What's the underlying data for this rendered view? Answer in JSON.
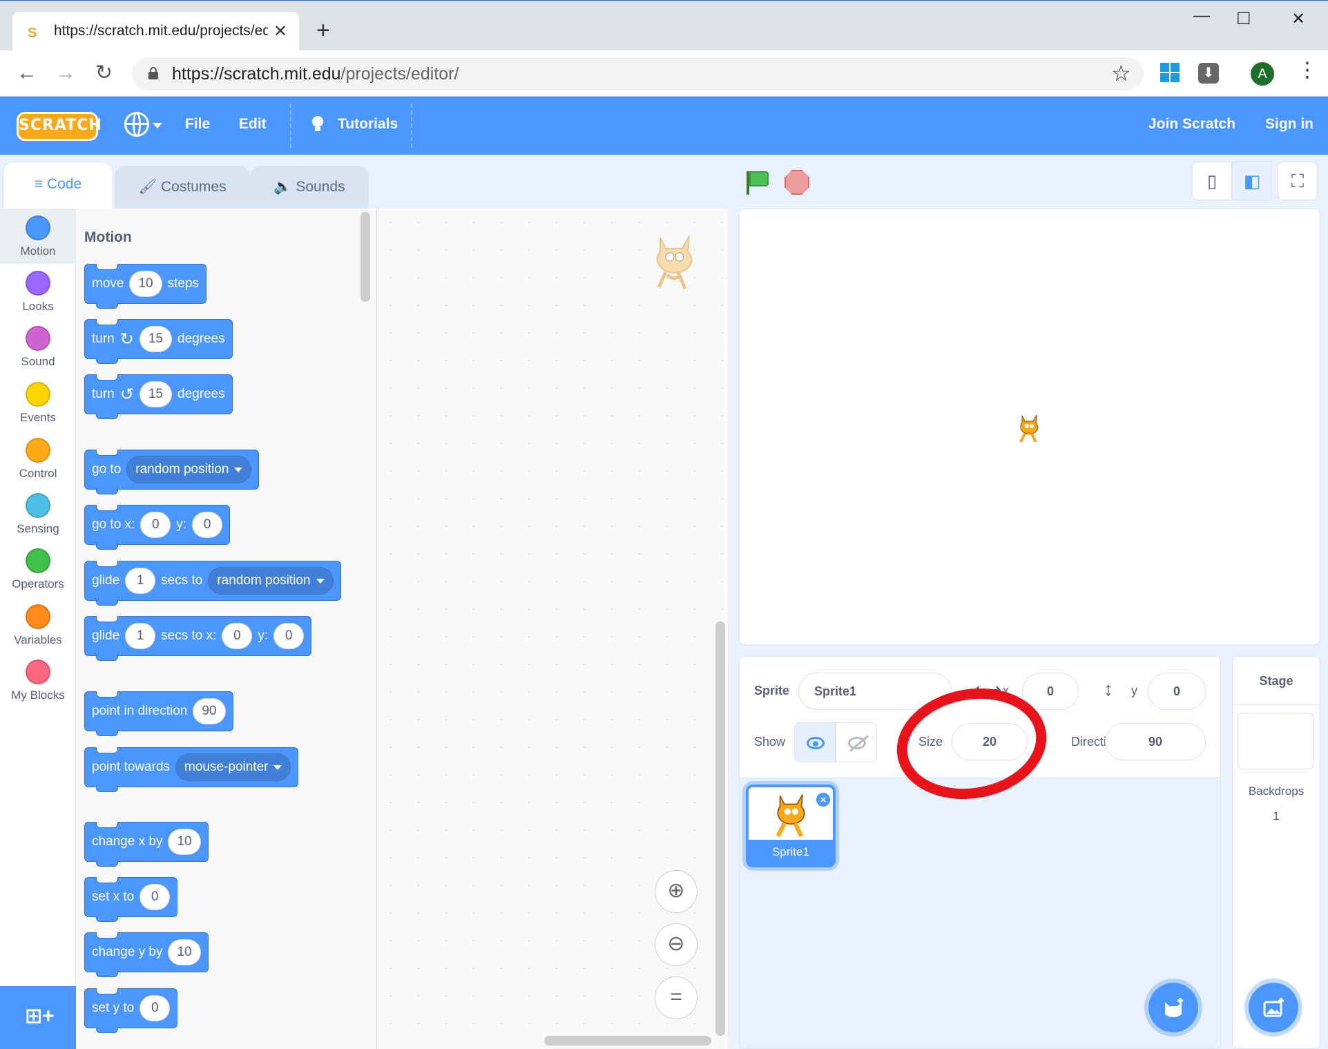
{
  "browser": {
    "tab_title": "https://scratch.mit.edu/projects/editor/",
    "tab_favicon": "S",
    "close_tab": "✕",
    "new_tab": "+",
    "window_minimize": "—",
    "window_maximize": "☐",
    "window_close": "✕",
    "back": "←",
    "forward": "→",
    "reload": "↻",
    "url_prefix": "https://scratch.mit.edu",
    "url_path": "/projects/editor/",
    "bookmark_star": "☆",
    "download_ext": "⬇",
    "profile_initial": "A",
    "menu": "⋮"
  },
  "menubar": {
    "logo": "SCRATCH",
    "file": "File",
    "edit": "Edit",
    "tutorials": "Tutorials",
    "join": "Join Scratch",
    "signin": "Sign in"
  },
  "editor_tabs": {
    "code": "Code",
    "costumes": "Costumes",
    "sounds": "Sounds",
    "code_icon": "≡",
    "costumes_icon": "🖌",
    "sounds_icon": "🔈"
  },
  "categories": [
    {
      "label": "Motion",
      "color": "#4c97ff"
    },
    {
      "label": "Looks",
      "color": "#9966ff"
    },
    {
      "label": "Sound",
      "color": "#cf63cf"
    },
    {
      "label": "Events",
      "color": "#ffd500"
    },
    {
      "label": "Control",
      "color": "#ffab19"
    },
    {
      "label": "Sensing",
      "color": "#4cbfe6"
    },
    {
      "label": "Operators",
      "color": "#40bf4a"
    },
    {
      "label": "Variables",
      "color": "#ff8c1a"
    },
    {
      "label": "My Blocks",
      "color": "#ff6680"
    }
  ],
  "extension_icon": "⊞+",
  "palette": {
    "title": "Motion",
    "move": {
      "a": "move",
      "v": "10",
      "b": "steps"
    },
    "turn_right": {
      "a": "turn",
      "icon": "↻",
      "v": "15",
      "b": "degrees"
    },
    "turn_left": {
      "a": "turn",
      "icon": "↺",
      "v": "15",
      "b": "degrees"
    },
    "goto": {
      "a": "go to",
      "menu": "random position"
    },
    "gotoxy": {
      "a": "go to x:",
      "x": "0",
      "b": "y:",
      "y": "0"
    },
    "glide_to": {
      "a": "glide",
      "v": "1",
      "b": "secs to",
      "menu": "random position"
    },
    "glide_xy": {
      "a": "glide",
      "v": "1",
      "b": "secs to x:",
      "x": "0",
      "c": "y:",
      "y": "0"
    },
    "point_dir": {
      "a": "point in direction",
      "v": "90"
    },
    "point_towards": {
      "a": "point towards",
      "menu": "mouse-pointer"
    },
    "change_x": {
      "a": "change x by",
      "v": "10"
    },
    "set_x": {
      "a": "set x to",
      "v": "0"
    },
    "change_y": {
      "a": "change y by",
      "v": "10"
    },
    "set_y": {
      "a": "set y to",
      "v": "0"
    }
  },
  "zoom": {
    "in": "⊕",
    "out": "⊖",
    "reset": "="
  },
  "stage_controls": {
    "small": "▯",
    "normal": "◧",
    "fullscreen": "⛶"
  },
  "sprite_info": {
    "sprite_label": "Sprite",
    "sprite_name": "Sprite1",
    "x_icon": "⟷",
    "x_label": "x",
    "x_value": "0",
    "y_icon": "↕",
    "y_label": "y",
    "y_value": "0",
    "show_label": "Show",
    "size_label": "Size",
    "size_value": "20",
    "direction_label": "Direction",
    "direction_value": "90"
  },
  "sprite_list": [
    {
      "name": "Sprite1",
      "delete": "×"
    }
  ],
  "stage_panel": {
    "title": "Stage",
    "backdrops_label": "Backdrops",
    "backdrops_count": "1"
  },
  "annotation_color": "#e8131b",
  "accent_color": "#4c97ff"
}
